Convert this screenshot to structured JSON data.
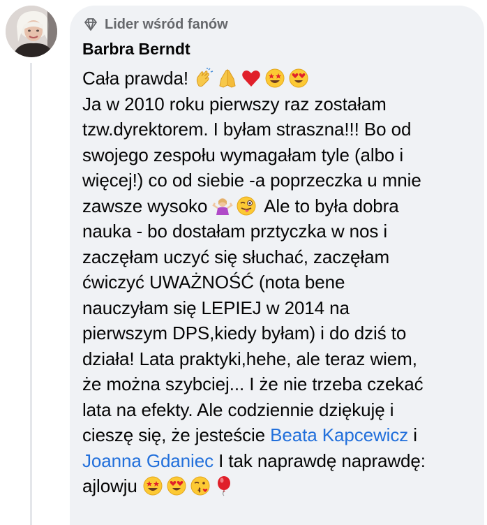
{
  "badge": {
    "icon": "diamond-icon",
    "label": "Lider wśród fanów"
  },
  "author": {
    "name": "Barbra Berndt"
  },
  "comment": {
    "l1": "Cała prawda!",
    "l2": "Ja w 2010 roku pierwszy raz zostałam",
    "l3": "tzw.dyrektorem. I byłam straszna!!! Bo od",
    "l4": "swojego zespołu wymagałam tyle (albo i",
    "l5": "więcej!) co od siebie -a poprzeczka u mnie",
    "l6a": "zawsze wysoko",
    "l6b": "Ale to była dobra",
    "l7": "nauka - bo dostałam prztyczka w nos i",
    "l8": "zaczęłam uczyć się słuchać, zaczęłam",
    "l9": "ćwiczyć UWAŻNOŚĆ (nota bene",
    "l10": "nauczyłam się LEPIEJ w 2014 na",
    "l11": "pierwszym DPS,kiedy byłam) i do dziś to",
    "l12": "działa! Lata praktyki,hehe, ale teraz wiem,",
    "l13": "że można szybciej... I że nie trzeba czekać",
    "l14": "lata na efekty. Ale codziennie dziękuję i",
    "l15a": "cieszę się, że jesteście",
    "l15b": "Beata Kapcewicz",
    "l15c": "i",
    "l16a": "Joanna Gdaniec",
    "l16b": "I tak naprawdę naprawdę:",
    "l17": "ajlowju",
    "mention_color": "#216fdb"
  },
  "emojis": {
    "line1": [
      "clapping-hands-icon",
      "folded-hands-icon",
      "red-heart-icon",
      "star-struck-icon",
      "heart-eyes-icon"
    ],
    "line6": [
      "person-shrugging-icon",
      "winking-face-tongue-icon"
    ],
    "line17": [
      "star-struck-icon",
      "heart-eyes-icon",
      "face-blowing-kiss-icon",
      "red-balloon-icon"
    ]
  },
  "colors": {
    "bubble": "#f0f2f5",
    "text": "#050505",
    "secondary": "#65676b",
    "link": "#216fdb"
  }
}
